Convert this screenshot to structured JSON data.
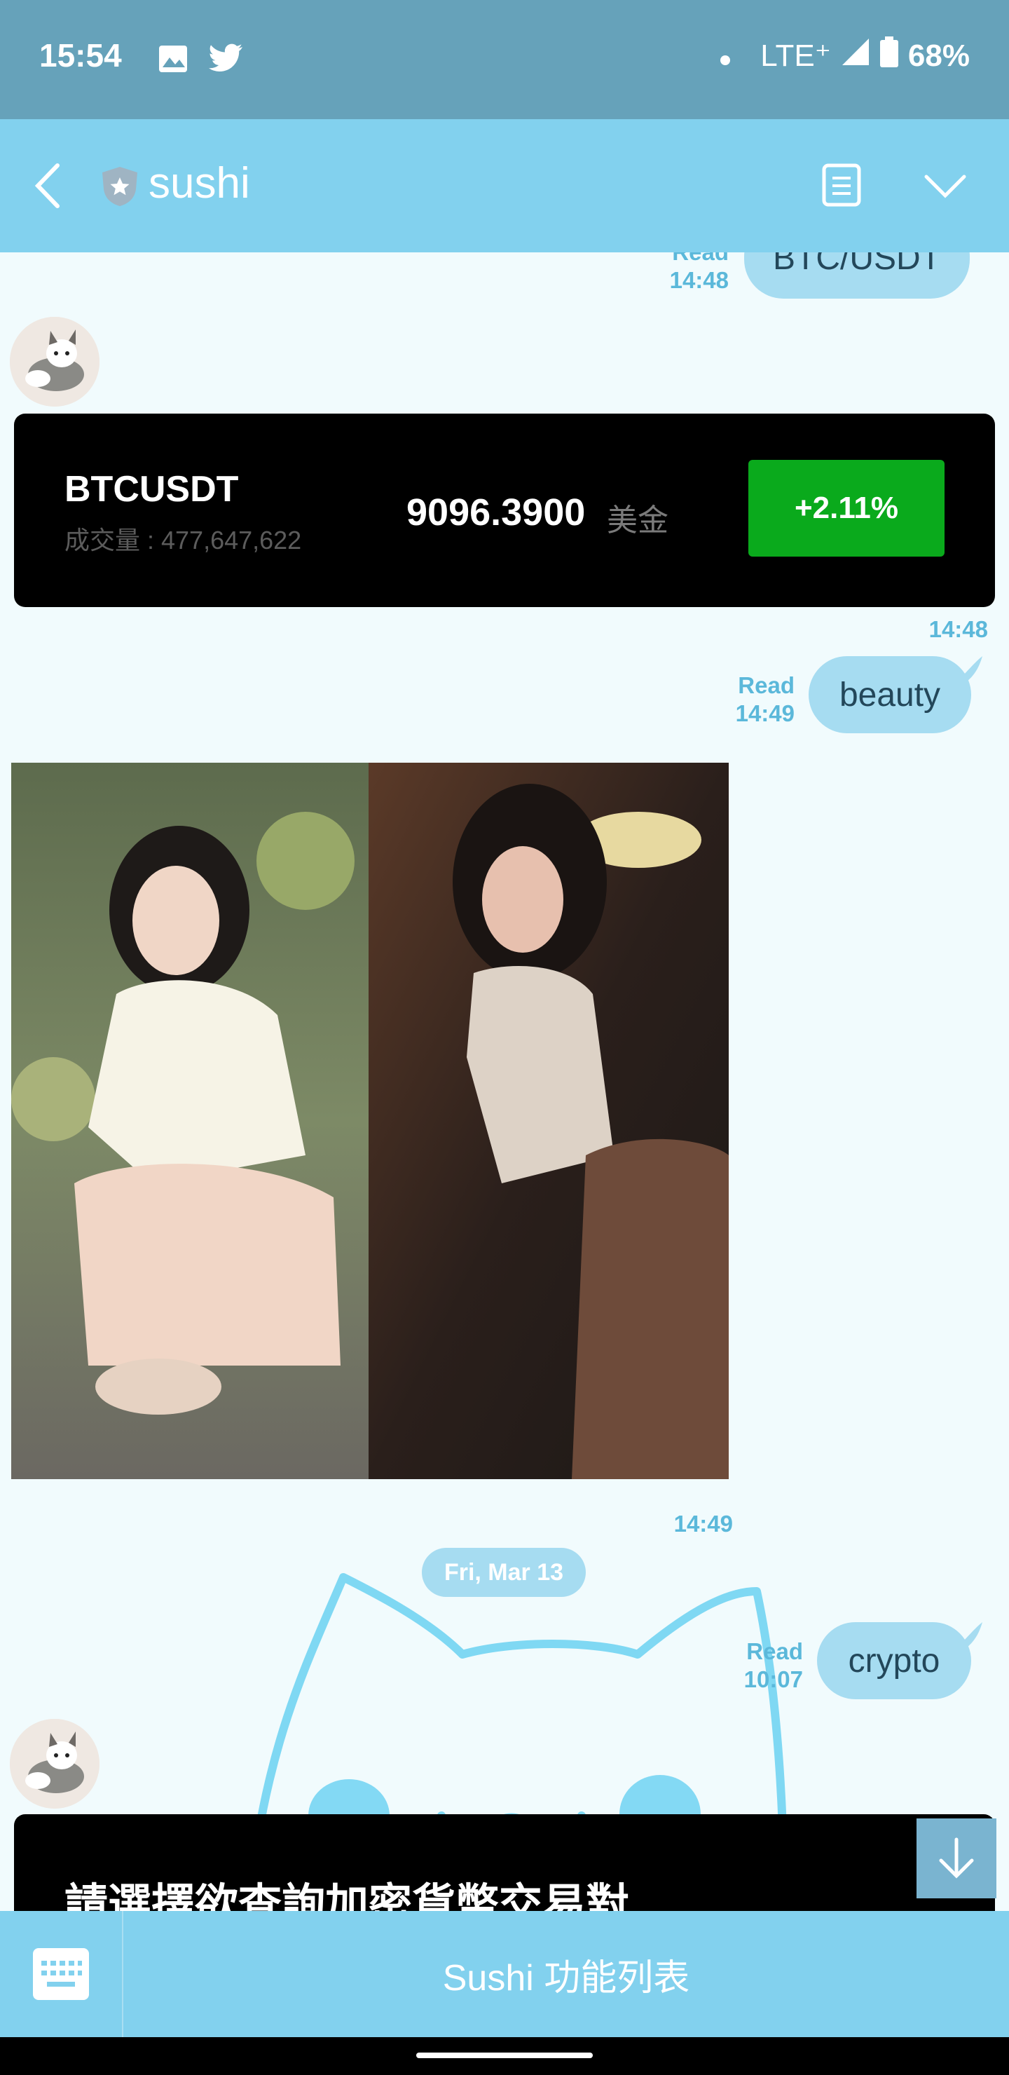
{
  "status": {
    "time": "15:54",
    "network": "LTE⁺",
    "battery": "68%",
    "icons": [
      "image-icon",
      "twitter-icon",
      "dot-icon",
      "signal-icon",
      "battery-icon"
    ]
  },
  "header": {
    "title": "sushi",
    "icons": [
      "back-icon",
      "shield-star-icon",
      "notes-icon",
      "chevron-down-icon"
    ]
  },
  "messages": {
    "m1": {
      "text": "BTC/USDT",
      "read": "Read",
      "time": "14:48"
    },
    "ticker": {
      "symbol": "BTCUSDT",
      "volume_label": "成交量 : 477,647,622",
      "price": "9096.3900",
      "currency": "美金",
      "change": "+2.11%",
      "time": "14:48"
    },
    "m2": {
      "text": "beauty",
      "read": "Read",
      "time": "14:49"
    },
    "images_time": "14:49",
    "date_chip": "Fri, Mar 13",
    "m3": {
      "text": "crypto",
      "read": "Read",
      "time": "10:07"
    },
    "crypto_card": {
      "title": "請選擇欲查詢加密貨幣交易對"
    }
  },
  "bottom": {
    "menu_label": "Sushi 功能列表",
    "keyboard_icon": "keyboard-icon"
  },
  "colors": {
    "status_bar": "#66a2ba",
    "header": "#82d1ee",
    "chat_bg": "#f1fbfd",
    "bubble": "#a6dcf1",
    "meta_text": "#5bb8da",
    "change_green": "#0aaa1c"
  }
}
